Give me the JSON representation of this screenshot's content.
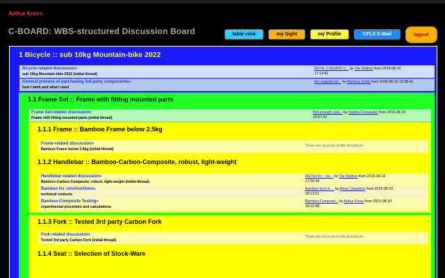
{
  "header": {
    "user_name": "Arthur Kress",
    "app_title": "C-BOARD: WBS-structured Discussion Board"
  },
  "nav": {
    "table_view": "table view",
    "my_sight": "my Sight",
    "my_profile": "my Profile",
    "cflx_email": "CFLX E-Mail",
    "logout": "logout"
  },
  "colors": {
    "level0": "#1a1aff",
    "level1": "#22ff22",
    "level2": "#ffff00",
    "title_text": "#ffff00",
    "user_text": "#ff2a2a"
  },
  "root": {
    "title": "1 Bicycle  ::  sub 10kg Mountain-bike 2022",
    "threads": [
      {
        "title": "Bicycle-related discussion»",
        "sub": "sub 10kg Mountain-bike 2022 (initial thread)",
        "last_link": "META: C-BOARD u...",
        "by": " by ",
        "author": "Ole Wallner",
        "date": " from 2015-08-10",
        "time": "17:13:41"
      },
      {
        "title": "General process of purchasing 3rd-party components»",
        "sub": "how I work and what I need",
        "last_link": "Re: support wit...",
        "by": " by ",
        "author": "Marlena Smith",
        "date": " from 2015-08-10 13:38:42",
        "time": ""
      }
    ]
  },
  "frame_set": {
    "title": "1.1 Frame Set  ::  Frame with fitting mounted parts",
    "threads": [
      {
        "title": "Frame Set-related discussion»",
        "sub": "Frame with fitting mounted parts (initial thread)",
        "last_link": "Not enough carb...",
        "by": " by ",
        "author": "Sophia Fernandez",
        "date": " from 2015-08-10",
        "time": "16:57:30"
      }
    ]
  },
  "frame": {
    "title": "1.1.1 Frame  ::  Bamboo Frame below 2.5kg",
    "threads": [
      {
        "title": "Frame-related discussion»",
        "sub": "Bamboo Frame below 2.5kg (initial thread)",
        "empty": "There are no posts in this thread yet"
      }
    ]
  },
  "handlebar": {
    "title": "1.1.2 Handlebar  ::  Bamboo-Carbon-Composite, robust, light-weight",
    "threads": [
      {
        "title": "Handlebar-related discussion»",
        "sub": "Bamboo-Carbon-Composite, robust, light-weight (initial thread)",
        "last_link": "META info :: Ha...",
        "by": " by ",
        "author": "Ole Wallner",
        "date": " from 2015-08-10",
        "time": "17:36:44"
      },
      {
        "title": "Bamboo for constructions»",
        "sub": "technical contexts",
        "last_link": "Bamboo tech in ...",
        "by": " by ",
        "author": "Amar Chandran",
        "date": " from 2015-08-10",
        "time": "18:13:11"
      },
      {
        "title": "Bamboo-Composite Testing»",
        "sub": "experimental procedure and calculations",
        "last_link": "Bamboo-Composit...",
        "by": " by ",
        "author": "Arthur Kress",
        "date": " from 2015-08-10",
        "time": "18:22:48"
      }
    ]
  },
  "fork": {
    "title": "1.1.3 Fork  ::  Tested 3rd party Carbon Fork",
    "threads": [
      {
        "title": "Fork-related discussion»",
        "sub": "Tested 3rd party Carbon Fork (initial thread)",
        "empty": "There are no posts in this thread yet"
      }
    ]
  },
  "seat": {
    "title": "1.1.4 Seat  ::  Selection of Stock-Ware"
  }
}
